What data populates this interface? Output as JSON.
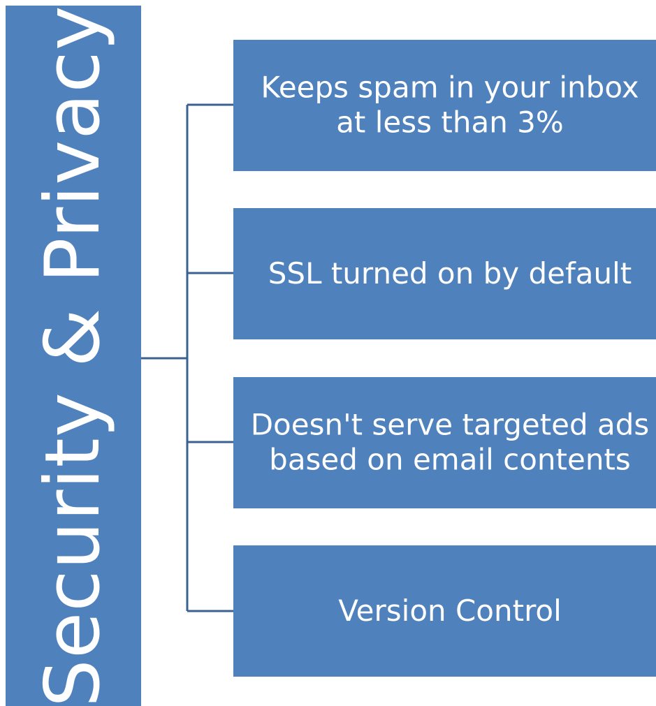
{
  "diagram": {
    "root": {
      "label": "Security & Privacy"
    },
    "children": [
      {
        "lines": [
          "Keeps spam in your inbox",
          "at less than 3%"
        ]
      },
      {
        "lines": [
          "SSL turned on by default"
        ]
      },
      {
        "lines": [
          "Doesn't serve targeted ads",
          "based on email contents"
        ]
      },
      {
        "lines": [
          "Version Control"
        ]
      }
    ]
  },
  "colors": {
    "box_fill": "#4f81bd",
    "connector": "#3a6190",
    "text": "#ffffff"
  }
}
